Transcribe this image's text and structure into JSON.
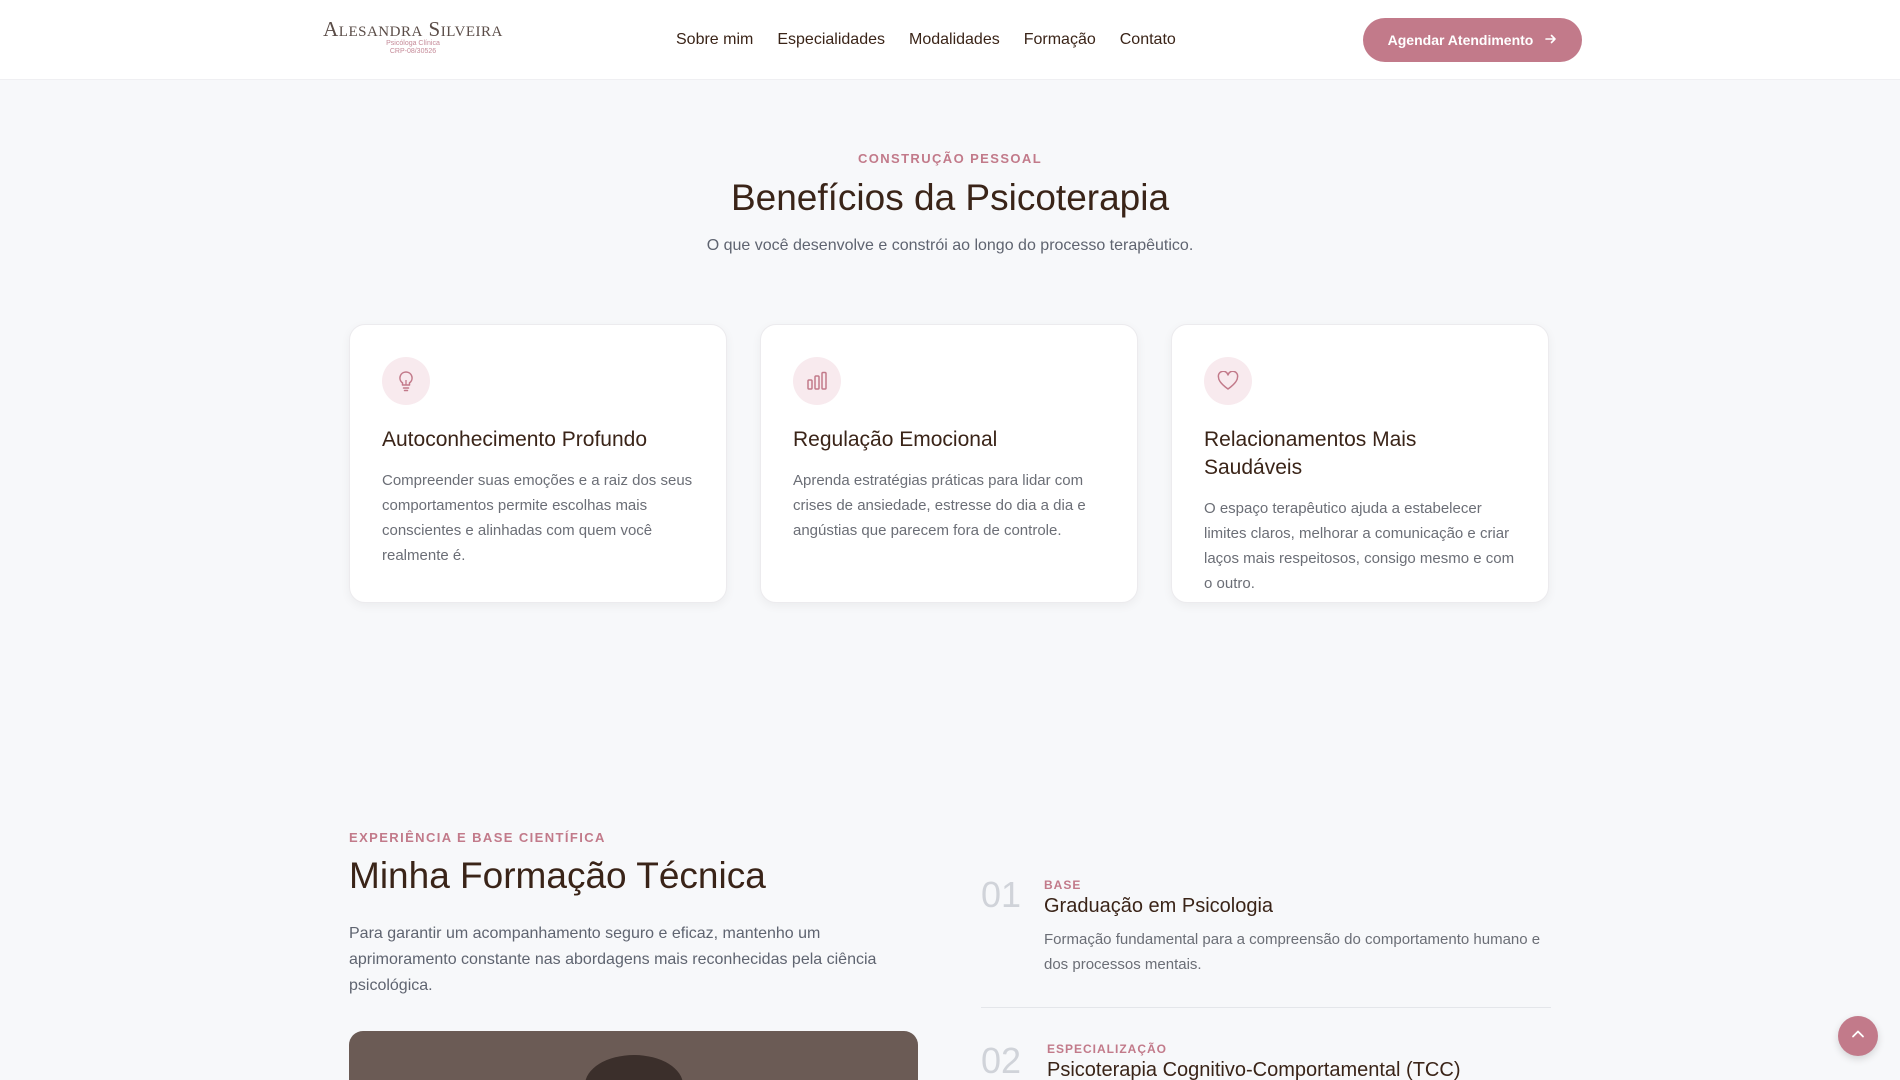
{
  "header": {
    "logo_name": "Alesandra Silveira",
    "logo_role": "Psicóloga Clínica",
    "logo_crp": "CRP-08/30526",
    "nav": [
      "Sobre mim",
      "Especialidades",
      "Modalidades",
      "Formação",
      "Contato"
    ],
    "cta_label": "Agendar Atendimento"
  },
  "benefits": {
    "eyebrow": "CONSTRUÇÃO PESSOAL",
    "title": "Benefícios da Psicoterapia",
    "subtitle": "O que você desenvolve e constrói ao longo do processo terapêutico.",
    "cards": [
      {
        "icon": "lightbulb-icon",
        "title": "Autoconhecimento Profundo",
        "text": "Compreender suas emoções e a raiz dos seus comportamentos permite escolhas mais conscientes e alinhadas com quem você realmente é."
      },
      {
        "icon": "bar-chart-icon",
        "title": "Regulação Emocional",
        "text": "Aprenda estratégias práticas para lidar com crises de ansiedade, estresse do dia a dia e angústias que parecem fora de controle."
      },
      {
        "icon": "heart-icon",
        "title": "Relacionamentos Mais Saudáveis",
        "text": "O espaço terapêutico ajuda a estabelecer limites claros, melhorar a comunicação e criar laços mais respeitosos, consigo mesmo e com o outro."
      }
    ]
  },
  "training": {
    "eyebrow": "EXPERIÊNCIA E BASE CIENTÍFICA",
    "title": "Minha Formação Técnica",
    "text": "Para garantir um acompanhamento seguro e eficaz, mantenho um aprimoramento constante nas abordagens mais reconhecidas pela ciência psicológica.",
    "items": [
      {
        "num": "01",
        "label": "BASE",
        "title": "Graduação em Psicologia",
        "desc": "Formação fundamental para a compreensão do comportamento humano e dos processos mentais."
      },
      {
        "num": "02",
        "label": "ESPECIALIZAÇÃO",
        "title": "Psicoterapia Cognitivo-Comportamental (TCC)",
        "desc": ""
      }
    ]
  },
  "colors": {
    "accent": "#c27a8a",
    "heading": "#3a2418",
    "background": "#f7f8fa"
  }
}
